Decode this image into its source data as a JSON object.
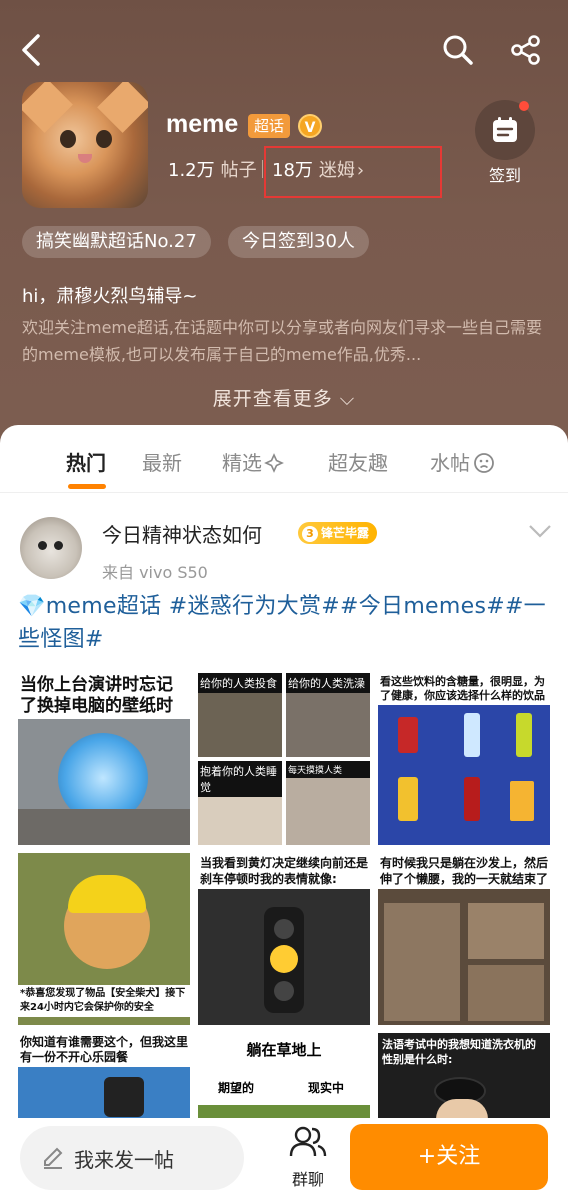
{
  "topbar": {
    "back_icon": "back-arrow-icon",
    "search_icon": "search-icon",
    "share_icon": "share-icon"
  },
  "topic": {
    "name": "meme",
    "badge": "超话",
    "verified_icon": "v-icon",
    "posts_count": "1.2万",
    "posts_label": "帖子",
    "fans_count": "18万",
    "fans_label": "迷姆",
    "fans_chevron": "›",
    "checkin_label": "签到",
    "rank_pill": "搞笑幽默超话No.27",
    "checkin_pill": "今日签到30人",
    "greeting": "hi，肃穆火烈鸟辅导~",
    "description": "欢迎关注meme超话,在话题中你可以分享或者向网友们寻求一些自己需要的meme模板,也可以发布属于自己的meme作品,优秀...",
    "expand_label": "展开查看更多 ⌵"
  },
  "tabs": [
    {
      "label": "热门"
    },
    {
      "label": "最新"
    },
    {
      "label": "精选"
    },
    {
      "label": "超友趣"
    },
    {
      "label": "水帖"
    }
  ],
  "post": {
    "title": "今日精神状态如何",
    "badge_level": "3",
    "badge_label": "锋芒毕露",
    "from": "来自 vivo S50",
    "text": "💎meme超话 #迷惑行为大赏##今日memes##一些怪图#",
    "images": [
      {
        "caption": "当你上台演讲时忘记了换掉电脑的壁纸时"
      },
      {
        "caption_1": "给你的人类投食",
        "caption_2": "给你的人类洗澡",
        "caption_3": "抱着你的人类睡觉",
        "caption_4": "每天摸摸人类"
      },
      {
        "caption": "看这些饮料的含糖量，很明显，为了健康，你应该选择什么样的饮品"
      },
      {
        "caption": "*恭喜您发现了物品【安全柴犬】接下来24小时内它会保护你的安全"
      },
      {
        "caption": "当我看到黄灯决定继续向前还是刹车停顿时我的表情就像:"
      },
      {
        "caption": "有时候我只是躺在沙发上，然后伸了个懒腰，我的一天就结束了"
      },
      {
        "caption": "你知道有谁需要这个，但我这里有一份不开心乐园餐"
      },
      {
        "caption_1": "躺在草地上",
        "caption_2": "期望的",
        "caption_3": "现实中"
      },
      {
        "caption": "法语考试中的我想知道洗衣机的性别是什么时:"
      }
    ]
  },
  "bottom": {
    "compose_label": "我来发一帖",
    "groupchat_label": "群聊",
    "follow_label": "+关注"
  },
  "colors": {
    "accent": "#ff8c00",
    "header_bg": "#795a4d",
    "link": "#1f5f9a",
    "highlight": "#e53935"
  }
}
